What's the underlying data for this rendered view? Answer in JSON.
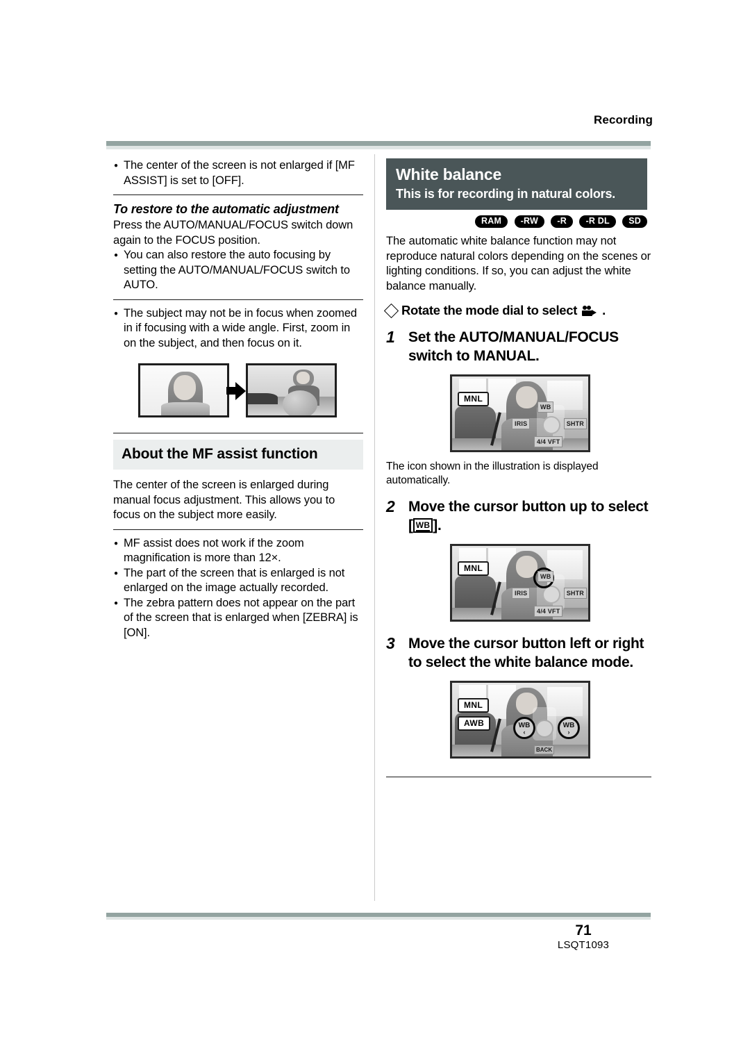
{
  "running_head": "Recording",
  "footer": {
    "page_number": "71",
    "doc_code": "LSQT1093"
  },
  "left_column": {
    "note_1": "The center of the screen is not enlarged if [MF ASSIST] is set to [OFF].",
    "restore_heading": "To restore to the automatic adjustment",
    "restore_body": "Press the AUTO/MANUAL/FOCUS switch down again to the FOCUS position.",
    "restore_note": "You can also restore the auto focusing by setting the AUTO/MANUAL/FOCUS switch to AUTO.",
    "zoom_note": "The subject may not be in focus when zoomed in if focusing with a wide angle. First, zoom in on the subject, and then focus on it.",
    "mf_assist_heading": "About the MF assist function",
    "mf_assist_body": "The center of the screen is enlarged during manual focus adjustment. This allows you to focus on the subject more easily.",
    "mf_notes": [
      "MF assist does not work if the zoom magnification is more than 12×.",
      "The part of the screen that is enlarged is not enlarged on the image actually recorded.",
      "The zebra pattern does not appear on the part of the screen that is enlarged when [ZEBRA] is [ON]."
    ]
  },
  "right_column": {
    "section_title": "White balance",
    "section_subtitle": "This is for recording in natural colors.",
    "media_badges": [
      "RAM",
      "-RW",
      "-R",
      "-R DL",
      "SD"
    ],
    "intro": "The automatic white balance function may not reproduce natural colors depending on the scenes or lighting conditions. If so, you can adjust the white balance manually.",
    "dial_line": "Rotate the mode dial to select",
    "dial_icon": "camcorder-icon",
    "step1": {
      "num": "1",
      "text": "Set the AUTO/MANUAL/FOCUS switch to MANUAL."
    },
    "step1_note": "The icon shown in the illustration is displayed automatically.",
    "step2": {
      "num": "2",
      "text_before": "Move the cursor button up to select [",
      "chip": "WB",
      "text_after": "]."
    },
    "step3": {
      "num": "3",
      "text": "Move the cursor button left or right to select the white balance mode."
    },
    "lcd1": {
      "badge_mnl": "MNL",
      "tag_top": "WB",
      "tag_left": "IRIS",
      "tag_right": "SHTR",
      "tag_bottom": "4/4 VFT"
    },
    "lcd2": {
      "badge_mnl": "MNL",
      "tag_top": "WB",
      "tag_left": "IRIS",
      "tag_right": "SHTR",
      "tag_bottom": "4/4 VFT"
    },
    "lcd3": {
      "badge_mnl": "MNL",
      "badge_awb": "AWB",
      "left_circle": "WB",
      "left_arrow": "‹",
      "right_circle": "WB",
      "right_arrow": "›",
      "bottom_tag": "BACK"
    }
  },
  "colors": {
    "rule": "#93a4a1",
    "rule_light": "#dfe5e4",
    "dark_head_bg": "#4a5658",
    "band_head_bg": "#ebeeee",
    "badge_bg": "#000000"
  }
}
